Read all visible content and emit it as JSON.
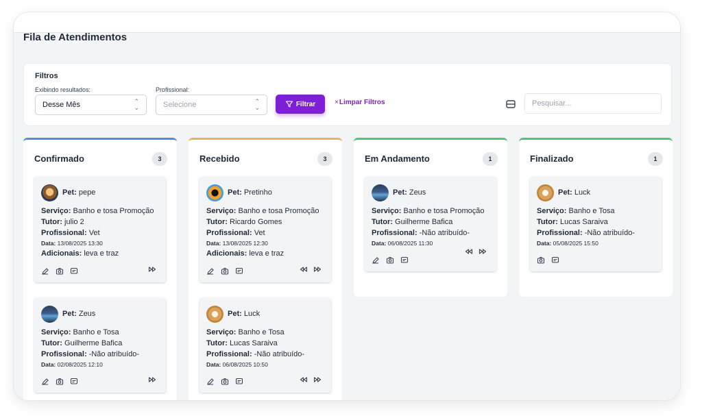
{
  "page_title": "Fila de Atendimentos",
  "filters": {
    "title": "Filtros",
    "exibindo_label": "Exibindo resultados:",
    "exibindo_value": "Desse Mês",
    "profissional_label": "Profissional:",
    "profissional_placeholder": "Selecione",
    "filter_button": "Filtrar",
    "clear_x": "×",
    "clear_button": "Limpar Filtros",
    "search_placeholder": "Pesquisar..."
  },
  "labels": {
    "pet": "Pet:",
    "servico": "Serviço:",
    "tutor": "Tutor:",
    "profissional": "Profissional:",
    "data": "Data:",
    "adicionais": "Adicionais:"
  },
  "columns": [
    {
      "title": "Confirmado",
      "count": "3",
      "accent": "#4f8fd6",
      "cards": [
        {
          "pet": "pepe",
          "servico": "Banho e tosa Promoção",
          "tutor": "julio 2",
          "profissional": "Vet",
          "data": "13/08/2025 13:30",
          "adicionais": "leva e traz"
        },
        {
          "pet": "Zeus",
          "servico": "Banho e Tosa",
          "tutor": "Guilherme Bafica",
          "profissional": "-Não atribuído-",
          "data": "02/08/2025 12:10"
        }
      ]
    },
    {
      "title": "Recebido",
      "count": "3",
      "accent": "#e9b35a",
      "cards": [
        {
          "pet": "Pretinho",
          "servico": "Banho e tosa Promoção",
          "tutor": "Ricardo Gomes",
          "profissional": "Vet",
          "data": "13/08/2025 12:30",
          "adicionais": "leva e traz"
        },
        {
          "pet": "Luck",
          "servico": "Banho e Tosa",
          "tutor": "Lucas Saraiva",
          "profissional": "-Não atribuído-",
          "data": "06/08/2025 10:50"
        }
      ]
    },
    {
      "title": "Em Andamento",
      "count": "1",
      "accent": "#4cc57c",
      "cards": [
        {
          "pet": "Zeus",
          "servico": "Banho e tosa Promoção",
          "tutor": "Guilherme Bafica",
          "profissional": "-Não atribuído-",
          "data": "06/08/2025 11:30"
        }
      ]
    },
    {
      "title": "Finalizado",
      "count": "1",
      "accent": "#4cc57c",
      "cards": [
        {
          "pet": "Luck",
          "servico": "Banho e Tosa",
          "tutor": "Lucas Saraiva",
          "profissional": "-Não atribuído-",
          "data": "05/08/2025 15:50"
        }
      ]
    }
  ],
  "icons": {
    "edit": "edit-icon",
    "camera": "camera-icon",
    "message": "message-icon",
    "prev": "rewind-icon",
    "next": "fast-forward-icon",
    "filter": "funnel-icon",
    "layout": "layout-icon"
  },
  "colors": {
    "primary": "#7c1fd6"
  }
}
